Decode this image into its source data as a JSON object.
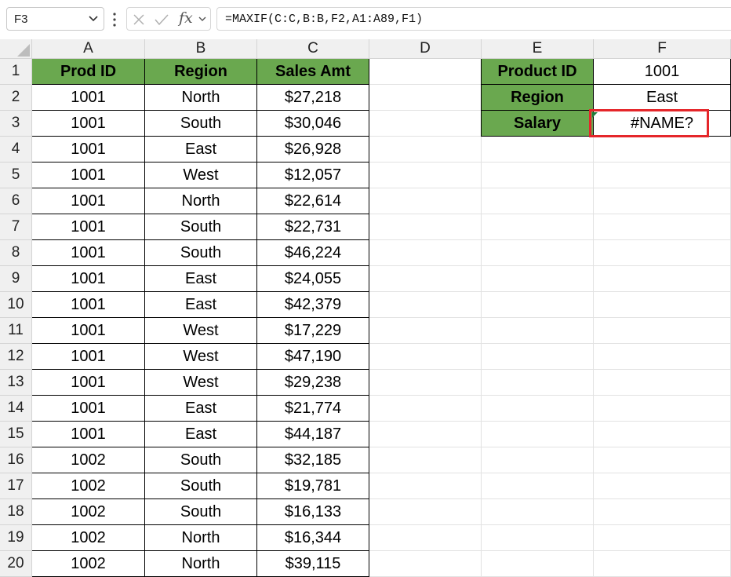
{
  "formula_bar": {
    "name_box": "F3",
    "fx_label": "fx",
    "formula": "=MAXIF(C:C,B:B,F2,A1:A89,F1)"
  },
  "columns": [
    "A",
    "B",
    "C",
    "D",
    "E",
    "F"
  ],
  "row_numbers": [
    "1",
    "2",
    "3",
    "4",
    "5",
    "6",
    "7",
    "8",
    "9",
    "10",
    "11",
    "12",
    "13",
    "14",
    "15",
    "16",
    "17",
    "18",
    "19",
    "20"
  ],
  "table": {
    "headers": [
      "Prod ID",
      "Region",
      "Sales Amt"
    ],
    "rows": [
      [
        "1001",
        "North",
        "$27,218"
      ],
      [
        "1001",
        "South",
        "$30,046"
      ],
      [
        "1001",
        "East",
        "$26,928"
      ],
      [
        "1001",
        "West",
        "$12,057"
      ],
      [
        "1001",
        "North",
        "$22,614"
      ],
      [
        "1001",
        "South",
        "$22,731"
      ],
      [
        "1001",
        "South",
        "$46,224"
      ],
      [
        "1001",
        "East",
        "$24,055"
      ],
      [
        "1001",
        "East",
        "$42,379"
      ],
      [
        "1001",
        "West",
        "$17,229"
      ],
      [
        "1001",
        "West",
        "$47,190"
      ],
      [
        "1001",
        "West",
        "$29,238"
      ],
      [
        "1001",
        "East",
        "$21,774"
      ],
      [
        "1001",
        "East",
        "$44,187"
      ],
      [
        "1002",
        "South",
        "$32,185"
      ],
      [
        "1002",
        "South",
        "$19,781"
      ],
      [
        "1002",
        "South",
        "$16,133"
      ],
      [
        "1002",
        "North",
        "$16,344"
      ],
      [
        "1002",
        "North",
        "$39,115"
      ]
    ]
  },
  "lookup": [
    {
      "label": "Product ID",
      "value": "1001"
    },
    {
      "label": "Region",
      "value": "East"
    },
    {
      "label": "Salary",
      "value": "#NAME?"
    }
  ],
  "colors": {
    "header_green": "#6aa84f",
    "selection_red": "#e5262a",
    "error_marker": "#1f7a3a"
  }
}
